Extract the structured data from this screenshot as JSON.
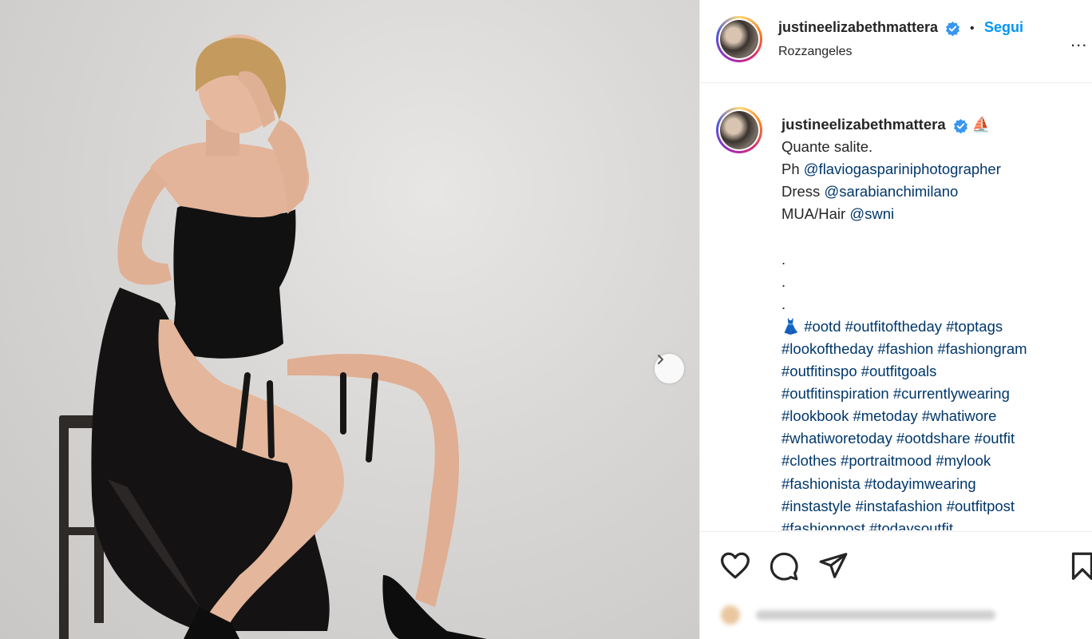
{
  "post": {
    "author": {
      "username": "justineelizabethmattera",
      "verified": true,
      "follow_separator": "•",
      "follow_label": "Segui",
      "location": "Rozzangeles",
      "more_label": "..."
    },
    "caption": {
      "username": "justineelizabethmattera",
      "emoji_after_name": "⛵",
      "lines": [
        "Quante salite."
      ],
      "credits": [
        {
          "prefix": "Ph ",
          "mention": "@flaviogaspariniphotographer"
        },
        {
          "prefix": "Dress ",
          "mention": "@sarabianchimilano"
        },
        {
          "prefix": "MUA/Hair ",
          "mention": "@swni"
        }
      ],
      "dots": [
        ".",
        ".",
        "."
      ],
      "hashtag_lead_emoji": "👗",
      "hashtag_lines": [
        "#ootd #outfitoftheday #toptags",
        "#lookoftheday #fashion #fashiongram",
        "#outfitinspo #outfitgoals",
        "#outfitinspiration #currentlywearing",
        "#lookbook #metoday #whatiwore",
        "#whatiworetoday #ootdshare #outfit",
        "#clothes #portraitmood #mylook",
        "#fashionista #todayimwearing",
        "#instastyle #instafashion #outfitpost",
        "#fashionpost #todaysoutfit"
      ]
    },
    "actions": {
      "like": "heart-icon",
      "comment": "comment-icon",
      "share": "send-icon",
      "save": "bookmark-icon"
    },
    "carousel_next": "chevron-right-icon"
  },
  "colors": {
    "link_blue": "#0095f6",
    "mention": "#00376b",
    "verified_badge": "#3897f0",
    "divider": "#efefef"
  }
}
